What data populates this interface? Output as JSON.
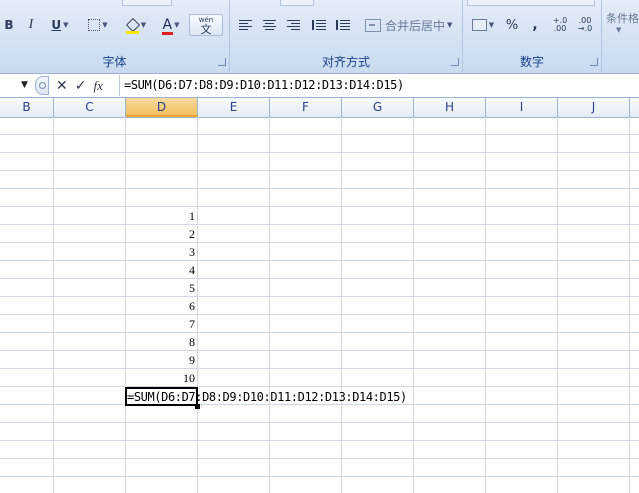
{
  "ribbon": {
    "font_group": {
      "label": "字体",
      "bold": "B",
      "italic": "I",
      "underline": "U",
      "font_color_letter": "A",
      "wen": "wén",
      "wen_char": "文"
    },
    "alignment_group": {
      "label": "对齐方式",
      "merge_center": "合并后居中"
    },
    "number_group": {
      "label": "数字",
      "percent": "%",
      "comma": ",",
      "inc_decimal": "+.0",
      "inc_decimal_2": ".00",
      "dec_decimal": ".00",
      "dec_decimal_2": "→.0"
    },
    "styles_group": {
      "conditional_format": "条件格"
    }
  },
  "formula_bar": {
    "formula": "=SUM(D6:D7:D8:D9:D10:D11:D12:D13:D14:D15)"
  },
  "columns": [
    "B",
    "C",
    "D",
    "E",
    "F",
    "G",
    "H",
    "I",
    "J"
  ],
  "active_column": "D",
  "cells": {
    "d_values": [
      "1",
      "2",
      "3",
      "4",
      "5",
      "6",
      "7",
      "8",
      "9",
      "10"
    ],
    "editing_text": "=SUM(D6:D7:D8:D9:D10:D11:D12:D13:D14:D15)"
  },
  "colors": {
    "ribbon_label": "#15428b",
    "header_text": "#27408b",
    "active_header": "#f1c15f",
    "grid_line": "#d0d7e5"
  }
}
